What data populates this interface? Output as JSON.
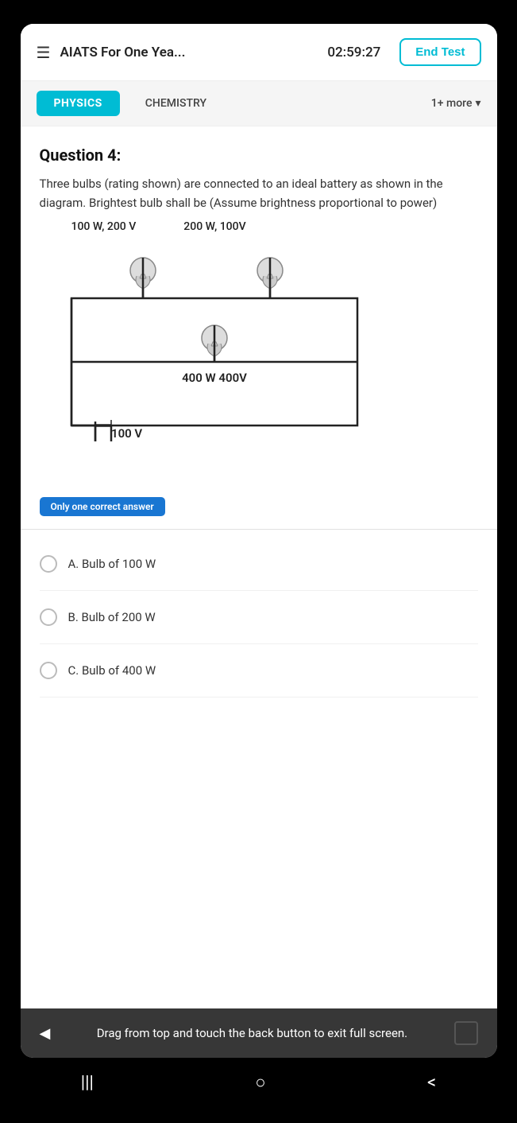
{
  "header": {
    "menu_icon": "☰",
    "title": "AIATS For One Yea...",
    "timer": "02:59:27",
    "end_test_label": "End Test"
  },
  "tabs": {
    "physics_label": "PHYSICS",
    "chemistry_label": "CHEMISTRY",
    "more_label": "1+ more"
  },
  "question": {
    "label": "Question 4:",
    "text": "Three bulbs (rating shown) are connected to an ideal battery as shown in the diagram. Brightest bulb shall be (Assume brightness proportional to power)",
    "bulb1_label": "100 W, 200 V",
    "bulb2_label": "200 W, 100V",
    "bulb3_label": "400 W 400V",
    "battery_label": "100 V"
  },
  "answer_type": {
    "badge": "Only one correct answer"
  },
  "options": [
    {
      "id": "A",
      "text": "A. Bulb of 100 W"
    },
    {
      "id": "B",
      "text": "B. Bulb of 200 W"
    },
    {
      "id": "C",
      "text": "C. Bulb of 400 W"
    }
  ],
  "toast": {
    "text": "Drag from top and touch the back button to exit full screen."
  },
  "bottom_nav": {
    "recent_apps": "|||",
    "home": "○",
    "back": "<"
  }
}
